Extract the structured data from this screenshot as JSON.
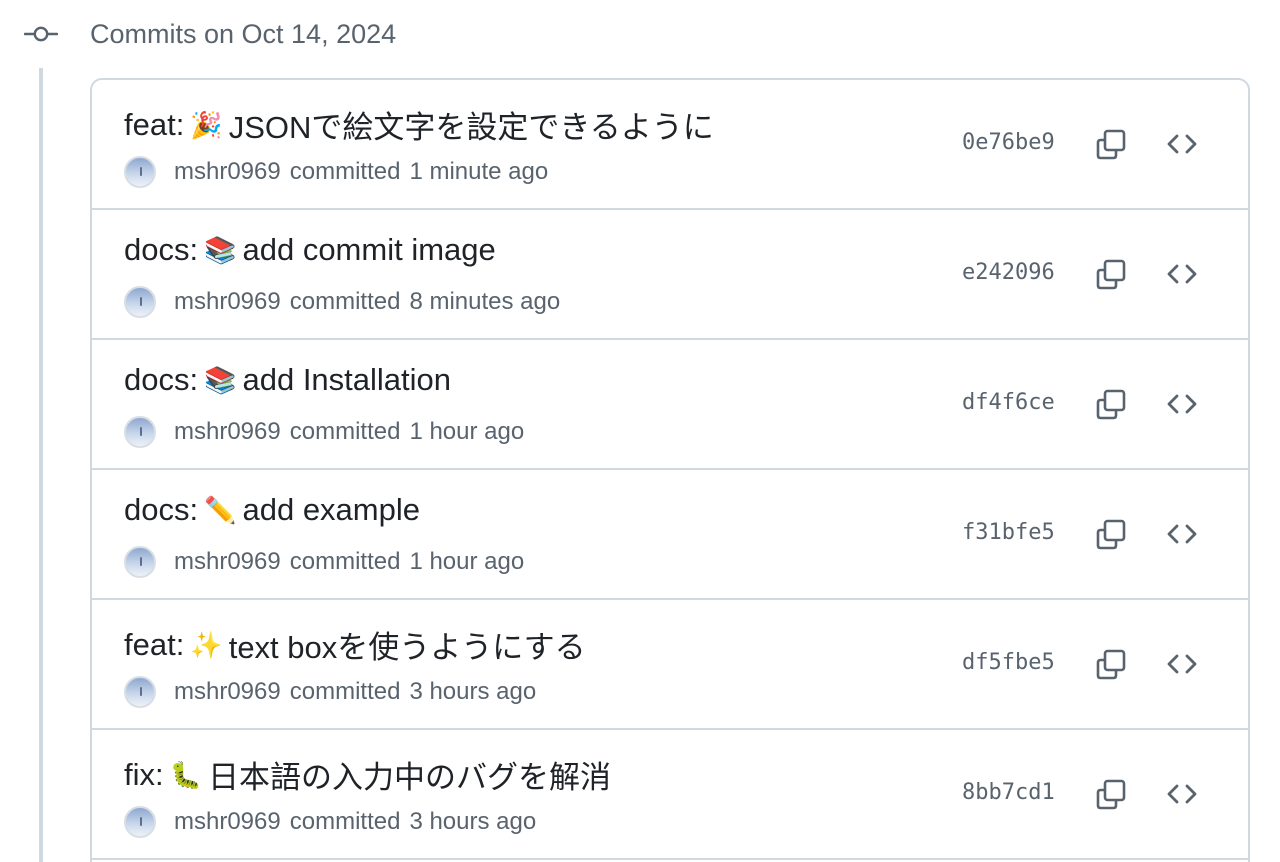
{
  "group": {
    "title": "Commits on Oct 14, 2024",
    "icon": "git-commit-icon"
  },
  "commits": [
    {
      "prefix": "feat:",
      "emoji": "🎉",
      "message": "JSONで絵文字を設定できるように",
      "author": "mshr0969",
      "verb": "committed",
      "time": "1 minute ago",
      "sha": "0e76be9"
    },
    {
      "prefix": "docs:",
      "emoji": "📚",
      "message": "add commit image",
      "author": "mshr0969",
      "verb": "committed",
      "time": "8 minutes ago",
      "sha": "e242096"
    },
    {
      "prefix": "docs:",
      "emoji": "📚",
      "message": "add Installation",
      "author": "mshr0969",
      "verb": "committed",
      "time": "1 hour ago",
      "sha": "df4f6ce"
    },
    {
      "prefix": "docs:",
      "emoji": "✏️",
      "message": "add example",
      "author": "mshr0969",
      "verb": "committed",
      "time": "1 hour ago",
      "sha": "f31bfe5"
    },
    {
      "prefix": "feat:",
      "emoji": "✨",
      "message": "text boxを使うようにする",
      "author": "mshr0969",
      "verb": "committed",
      "time": "3 hours ago",
      "sha": "df5fbe5"
    },
    {
      "prefix": "fix:",
      "emoji": "🐛",
      "message": "日本語の入力中のバグを解消",
      "author": "mshr0969",
      "verb": "committed",
      "time": "3 hours ago",
      "sha": "8bb7cd1"
    }
  ],
  "colors": {
    "text_primary": "#1f2328",
    "text_muted": "#59636e",
    "border": "#d1d9e0"
  },
  "icons": {
    "copy": "copy-icon",
    "browse": "code-icon"
  }
}
